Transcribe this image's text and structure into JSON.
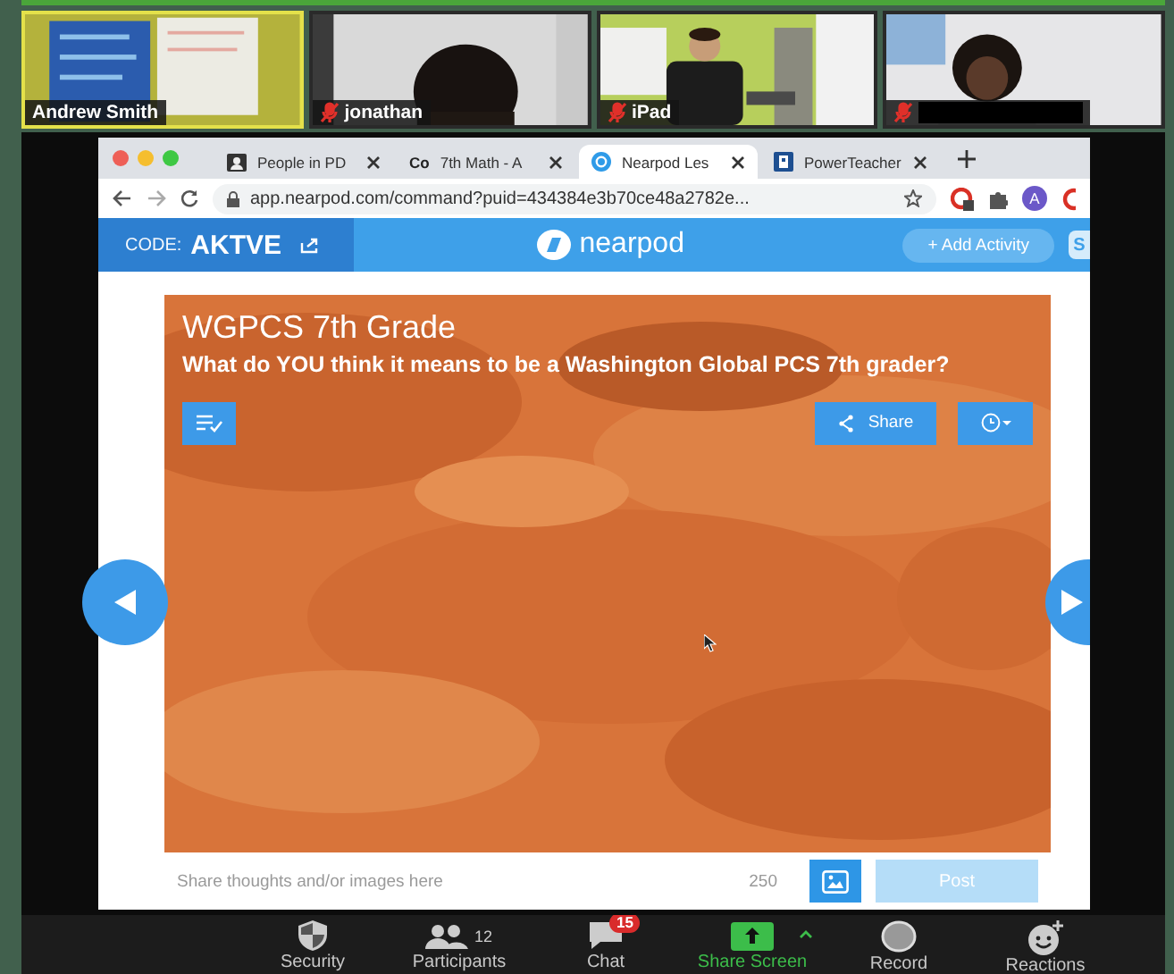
{
  "gallery": [
    {
      "name": "Andrew Smith",
      "muted": false,
      "speaking": true
    },
    {
      "name": "jonathan",
      "muted": true,
      "speaking": false
    },
    {
      "name": "iPad",
      "muted": true,
      "speaking": false
    },
    {
      "muted": true,
      "speaking": false,
      "name_redacted": true
    }
  ],
  "browser": {
    "tabs": [
      {
        "kind": "contacts",
        "title": "People in PD",
        "selected": false
      },
      {
        "kind": "lettered",
        "favicon_text": "Co",
        "title": "7th Math - A",
        "selected": false
      },
      {
        "kind": "nearpod",
        "title": "Nearpod Les",
        "selected": true
      },
      {
        "kind": "powerteacher",
        "title": "PowerTeacher",
        "selected": false
      }
    ],
    "url": "app.nearpod.com/command?puid=434384e3b70ce48a2782e...",
    "profile_initial": "A"
  },
  "nearpod": {
    "code_label": "CODE:",
    "code": "AKTVE",
    "logo": "nearpod",
    "add_button": "+ Add Activity",
    "side_badge": "S",
    "slide": {
      "title": "WGPCS 7th Grade",
      "question": "What do YOU think it means to be a Washington Global PCS 7th grader?",
      "share_button": "Share"
    },
    "response": {
      "placeholder": "Share thoughts and/or images here",
      "char_count": "250",
      "post_button": "Post",
      "post_disabled": true
    }
  },
  "toolbar": [
    {
      "kind": "security",
      "label": "Security"
    },
    {
      "kind": "participants",
      "label": "Participants",
      "count": "12"
    },
    {
      "kind": "chat",
      "label": "Chat",
      "badge": "15"
    },
    {
      "kind": "share",
      "label": "Share Screen"
    },
    {
      "kind": "record",
      "label": "Record"
    },
    {
      "kind": "reactions",
      "label": "Reactions"
    }
  ]
}
